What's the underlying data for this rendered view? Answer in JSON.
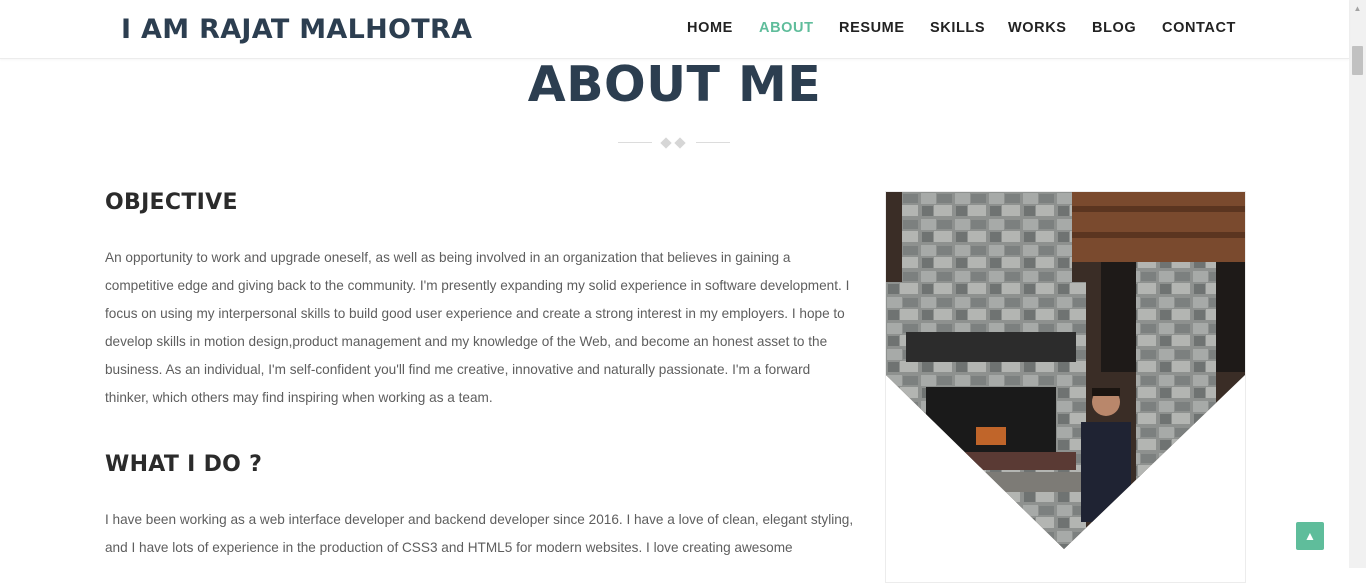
{
  "header": {
    "brand": "I AM RAJAT MALHOTRA",
    "nav": [
      {
        "label": "HOME",
        "active": false
      },
      {
        "label": "ABOUT",
        "active": true
      },
      {
        "label": "RESUME",
        "active": false
      },
      {
        "label": "SKILLS",
        "active": false
      },
      {
        "label": "WORKS",
        "active": false
      },
      {
        "label": "BLOG",
        "active": false
      },
      {
        "label": "CONTACT",
        "active": false
      }
    ]
  },
  "page": {
    "title": "ABOUT ME"
  },
  "objective": {
    "heading": "OBJECTIVE",
    "text": "An opportunity to work and upgrade oneself, as well as being involved in an organization that believes in gaining a competitive edge and giving back to the community. I'm presently expanding my solid experience in software development. I focus on using my interpersonal skills to build good user experience and create a strong interest in my employers. I hope to develop skills in motion design,product management and my knowledge of the Web, and become an honest asset to the business. As an individual, I'm self-confident you'll find me creative, innovative and naturally passionate. I'm a forward thinker, which others may find inspiring when working as a team."
  },
  "what_i_do": {
    "heading": "WHAT I DO ?",
    "text": "I have been working as a web interface developer and backend developer since 2016. I have a love of clean, elegant styling, and I have lots of experience in the production of CSS3 and HTML5 for modern websites. I love creating awesome"
  },
  "colors": {
    "accent": "#5fbd9b",
    "heading": "#2c3e50"
  },
  "icons": {
    "back_to_top": "chevron-up-icon",
    "scroll_up": "scroll-up-arrow-icon"
  }
}
